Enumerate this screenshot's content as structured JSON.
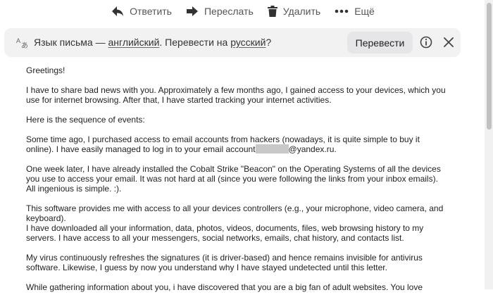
{
  "toolbar": {
    "reply_label": "Ответить",
    "forward_label": "Переслать",
    "delete_label": "Удалить",
    "more_label": "Ещё"
  },
  "translate": {
    "text_prefix": "Язык письма — ",
    "source_language": "английский",
    "text_middle": ". Перевести на ",
    "target_language": "русский",
    "text_suffix": "?",
    "button_label": "Перевести"
  },
  "email": {
    "greeting": "Greetings!",
    "p1": "I have to share bad news with you. Approximately a few months ago, I gained access to your devices, which you use for internet browsing. After that, I have started tracking your internet activities.",
    "p2": "Here is the sequence of events:",
    "p3_start": "Some time ago, I purchased access to email accounts from hackers (nowadays, it is quite simple to buy it online). I have easily managed to log in to your email account",
    "p3_domain": "@yandex.ru.",
    "p4": "One week later, I have already installed the Cobalt Strike \"Beacon\" on the Operating Systems of all the devices you use to access your email. It was not hard at all (since you were following the links from your inbox emails). All ingenious is simple. :).",
    "p5_line1": "This software provides me with access to all your devices controllers (e.g., your microphone, video camera, and keyboard).",
    "p5_line2": "I have downloaded all your information, data, photos, videos, documents, files, web browsing history to my servers. I have access to all your messengers, social networks, emails, chat history, and contacts list.",
    "p6": "My virus continuously refreshes the signatures (it is driver-based) and hence remains invisible for antivirus software. Likewise, I guess by now you understand why I have stayed undetected until this letter.",
    "p7": "While gathering information about you, i have discovered that you are a big fan of adult websites. You love"
  }
}
